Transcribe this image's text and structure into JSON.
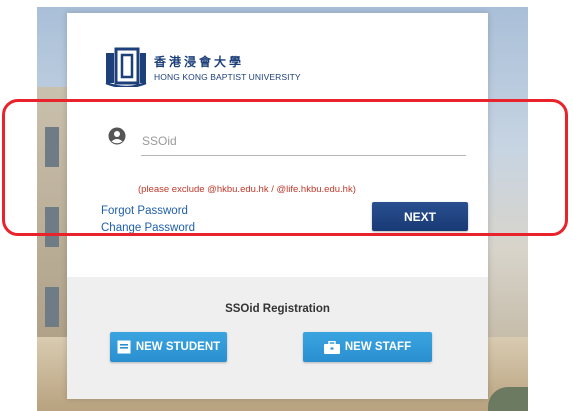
{
  "logo": {
    "chinese": "香港浸會大學",
    "english": "HONG KONG BAPTIST UNIVERSITY"
  },
  "login": {
    "user_icon": "user-circle-icon",
    "ssoid_placeholder": "SSOid",
    "ssoid_value": "",
    "hint": "(please exclude @hkbu.edu.hk / @life.hkbu.edu.hk)",
    "forgot_password": "Forgot Password",
    "change_password": "Change Password",
    "next_label": "NEXT"
  },
  "registration": {
    "title": "SSOid Registration",
    "new_student_label": "NEW STUDENT",
    "new_staff_label": "NEW STAFF",
    "student_icon": "id-card-icon",
    "staff_icon": "briefcase-icon"
  },
  "colors": {
    "brand_navy": "#1d3f7a",
    "next_button": "#183a75",
    "registration_button": "#2a8fcf",
    "hint_red": "#c0392b",
    "link_blue": "#1f5fa8",
    "highlight_red": "#e8232b"
  }
}
